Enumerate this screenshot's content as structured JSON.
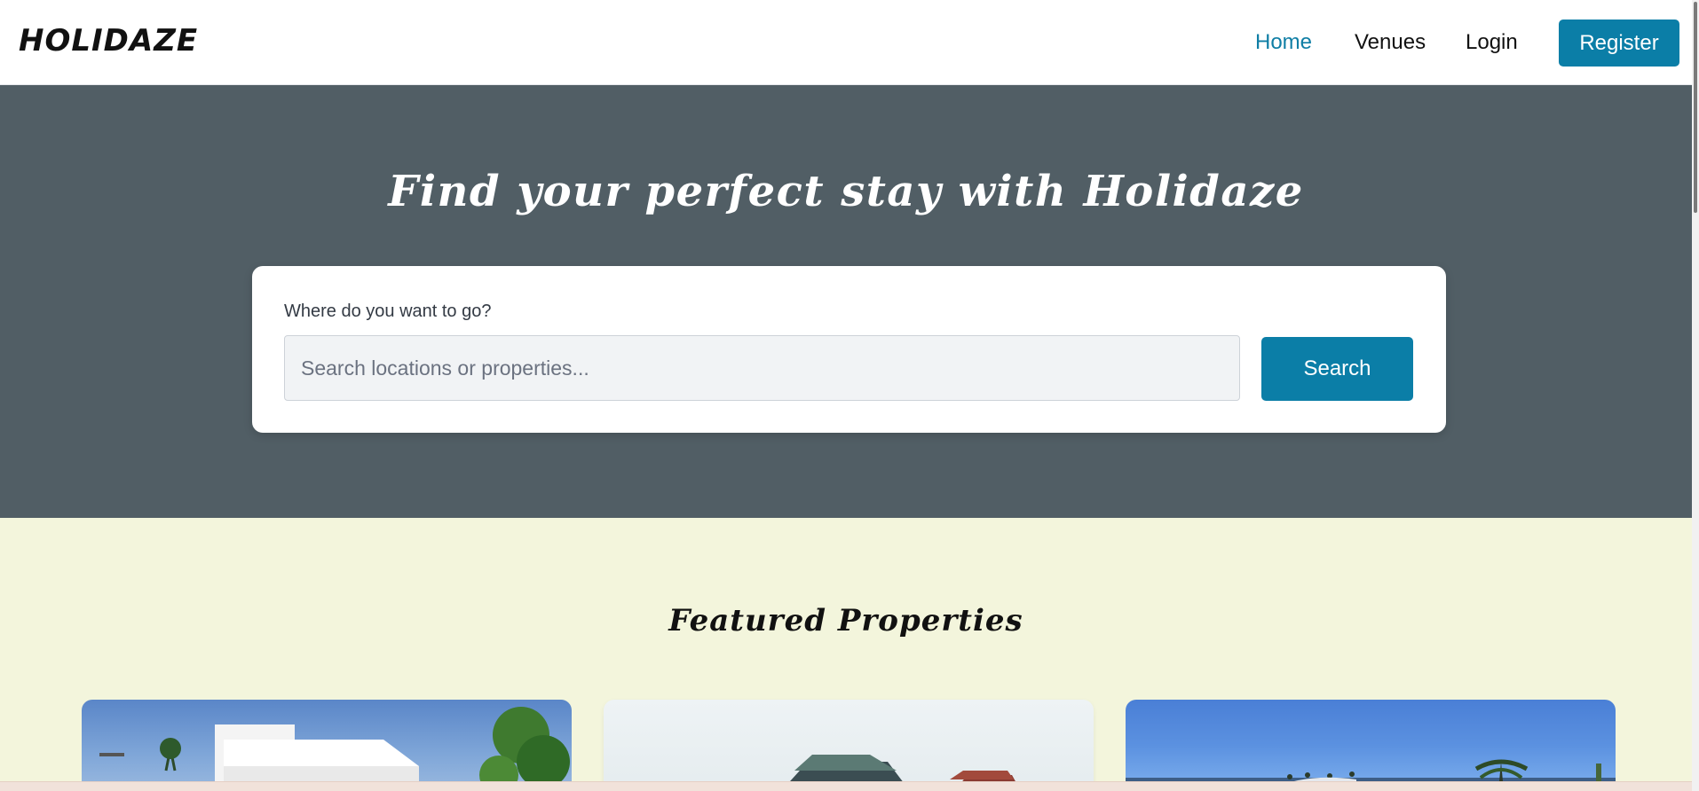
{
  "header": {
    "logo": "HOLIDAZE",
    "nav": {
      "home": "Home",
      "venues": "Venues",
      "login": "Login",
      "register": "Register"
    }
  },
  "hero": {
    "title": "Find your perfect stay with Holidaze",
    "search": {
      "label": "Where do you want to go?",
      "placeholder": "Search locations or properties...",
      "value": "",
      "button": "Search"
    }
  },
  "featured": {
    "title": "Featured Properties",
    "cards": [
      {
        "image": "villa-with-palm-trees"
      },
      {
        "image": "house-roof-under-light-sky"
      },
      {
        "image": "resort-under-blue-sky"
      }
    ]
  },
  "colors": {
    "accent": "#0b7ea7",
    "hero_bg": "#515e65",
    "section_bg": "#f3f5dc",
    "active_link": "#0f7ea5"
  }
}
